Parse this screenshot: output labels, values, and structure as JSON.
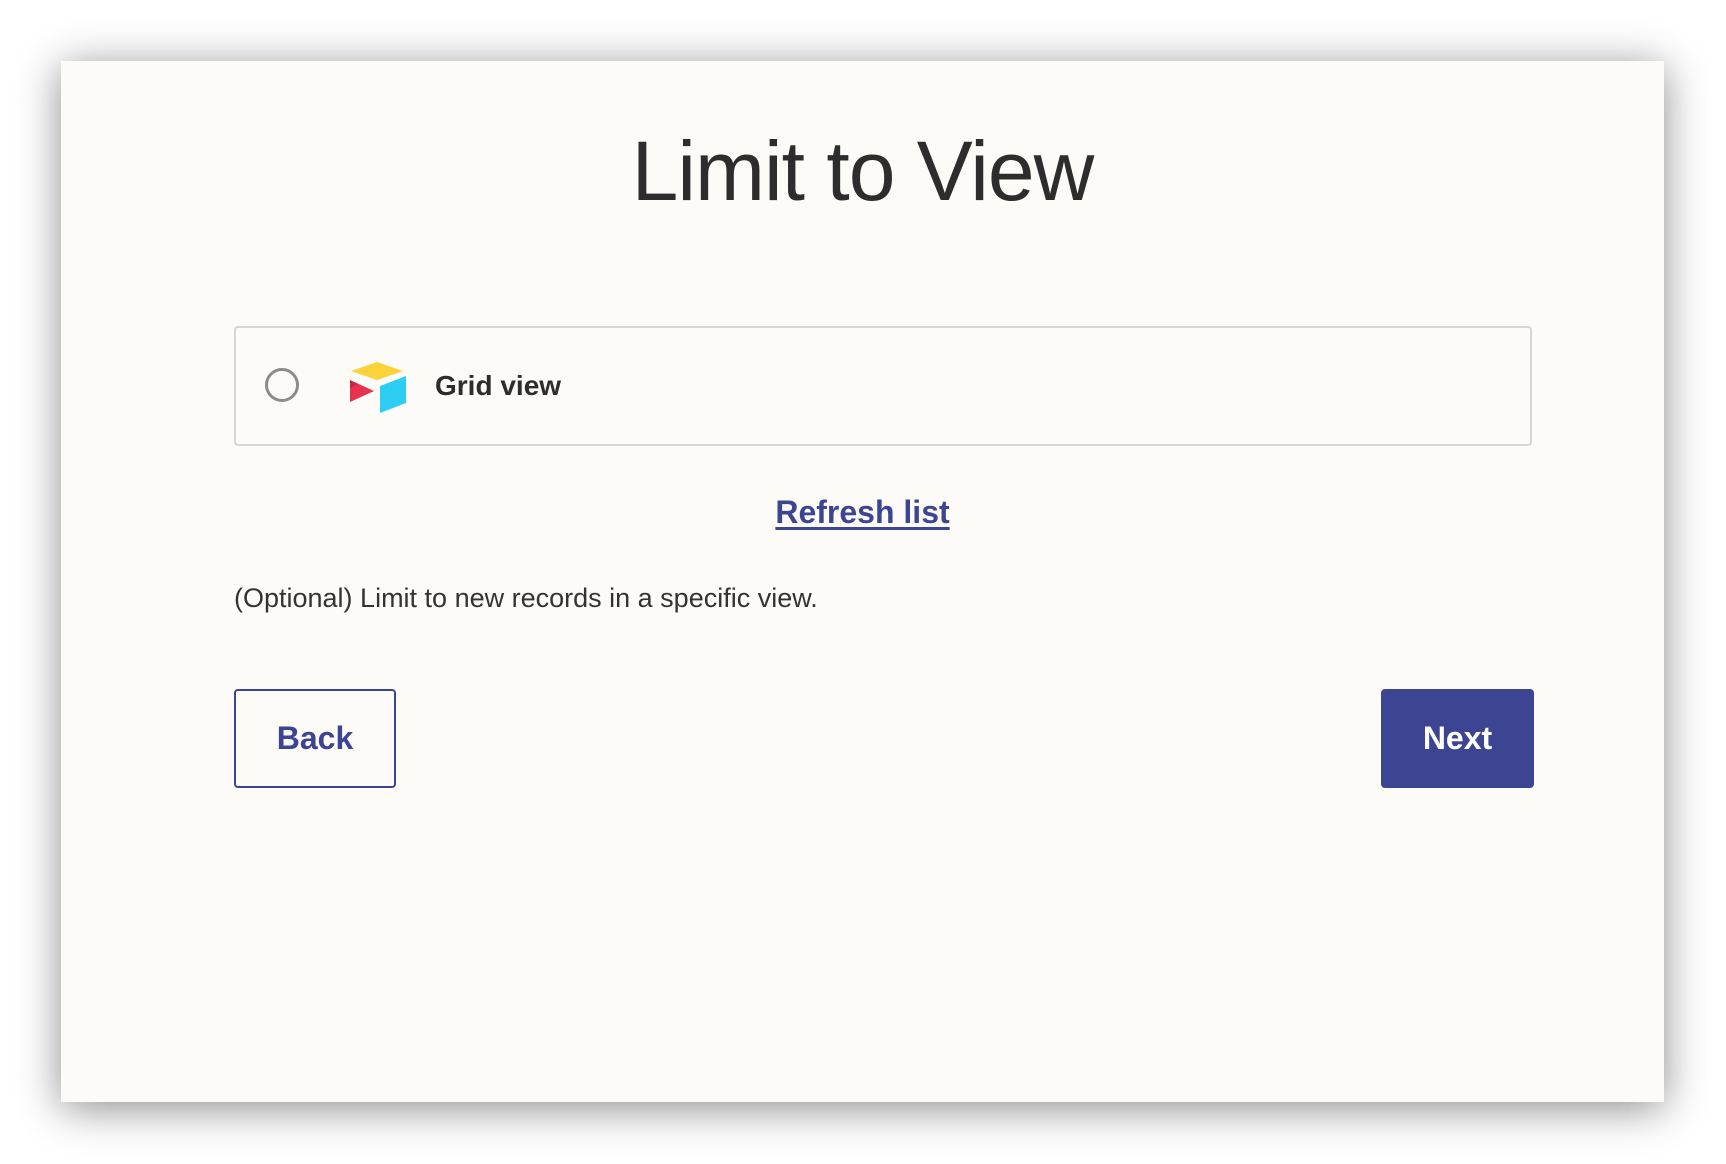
{
  "page": {
    "title": "Limit to View"
  },
  "options": [
    {
      "label": "Grid view",
      "selected": false,
      "icon": "airtable-logo-icon"
    }
  ],
  "refresh": {
    "label": "Refresh list"
  },
  "help": {
    "text": "(Optional) Limit to new records in a specific view."
  },
  "buttons": {
    "back_label": "Back",
    "next_label": "Next"
  },
  "colors": {
    "accent": "#3d4592",
    "background": "#fcfbf7",
    "logo_yellow": "#fcb400",
    "logo_red": "#f82b60",
    "logo_blue": "#18bfff"
  }
}
